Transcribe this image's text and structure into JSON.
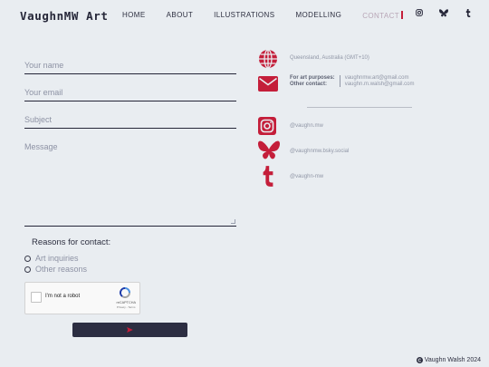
{
  "header": {
    "brand": "VaughnMW Art",
    "nav": [
      "HOME",
      "ABOUT",
      "ILLUSTRATIONS",
      "MODELLING",
      "CONTACT"
    ],
    "active": "CONTACT"
  },
  "social_top": [
    "instagram-icon",
    "bluesky-icon",
    "tumblr-icon"
  ],
  "form": {
    "name_placeholder": "Your name",
    "email_placeholder": "Your email",
    "subject_placeholder": "Subject",
    "message_placeholder": "Message",
    "reasons_title": "Reasons for contact:",
    "reasons": [
      "Art inquiries",
      "Other reasons"
    ],
    "captcha_label": "I'm not a robot",
    "captcha_brand": "reCAPTCHA",
    "captcha_terms": "Privacy - Terms"
  },
  "contact": {
    "location": "Queensland, Australia (GMT+10)",
    "emails": [
      {
        "label": "For art purposes:",
        "value": "vaughnmw.art@gmail.com"
      },
      {
        "label": "Other contact:",
        "value": "vaughn.m.walsh@gmail.com"
      }
    ],
    "instagram": "@vaughn.mw",
    "bluesky": "@vaughnmw.bsky.social",
    "tumblr": "@vaughn-mw"
  },
  "colors": {
    "accent": "#c41e3a",
    "dark": "#2c2e42",
    "bg": "#e9edf1"
  },
  "footer": "Vaughn Walsh 2024"
}
